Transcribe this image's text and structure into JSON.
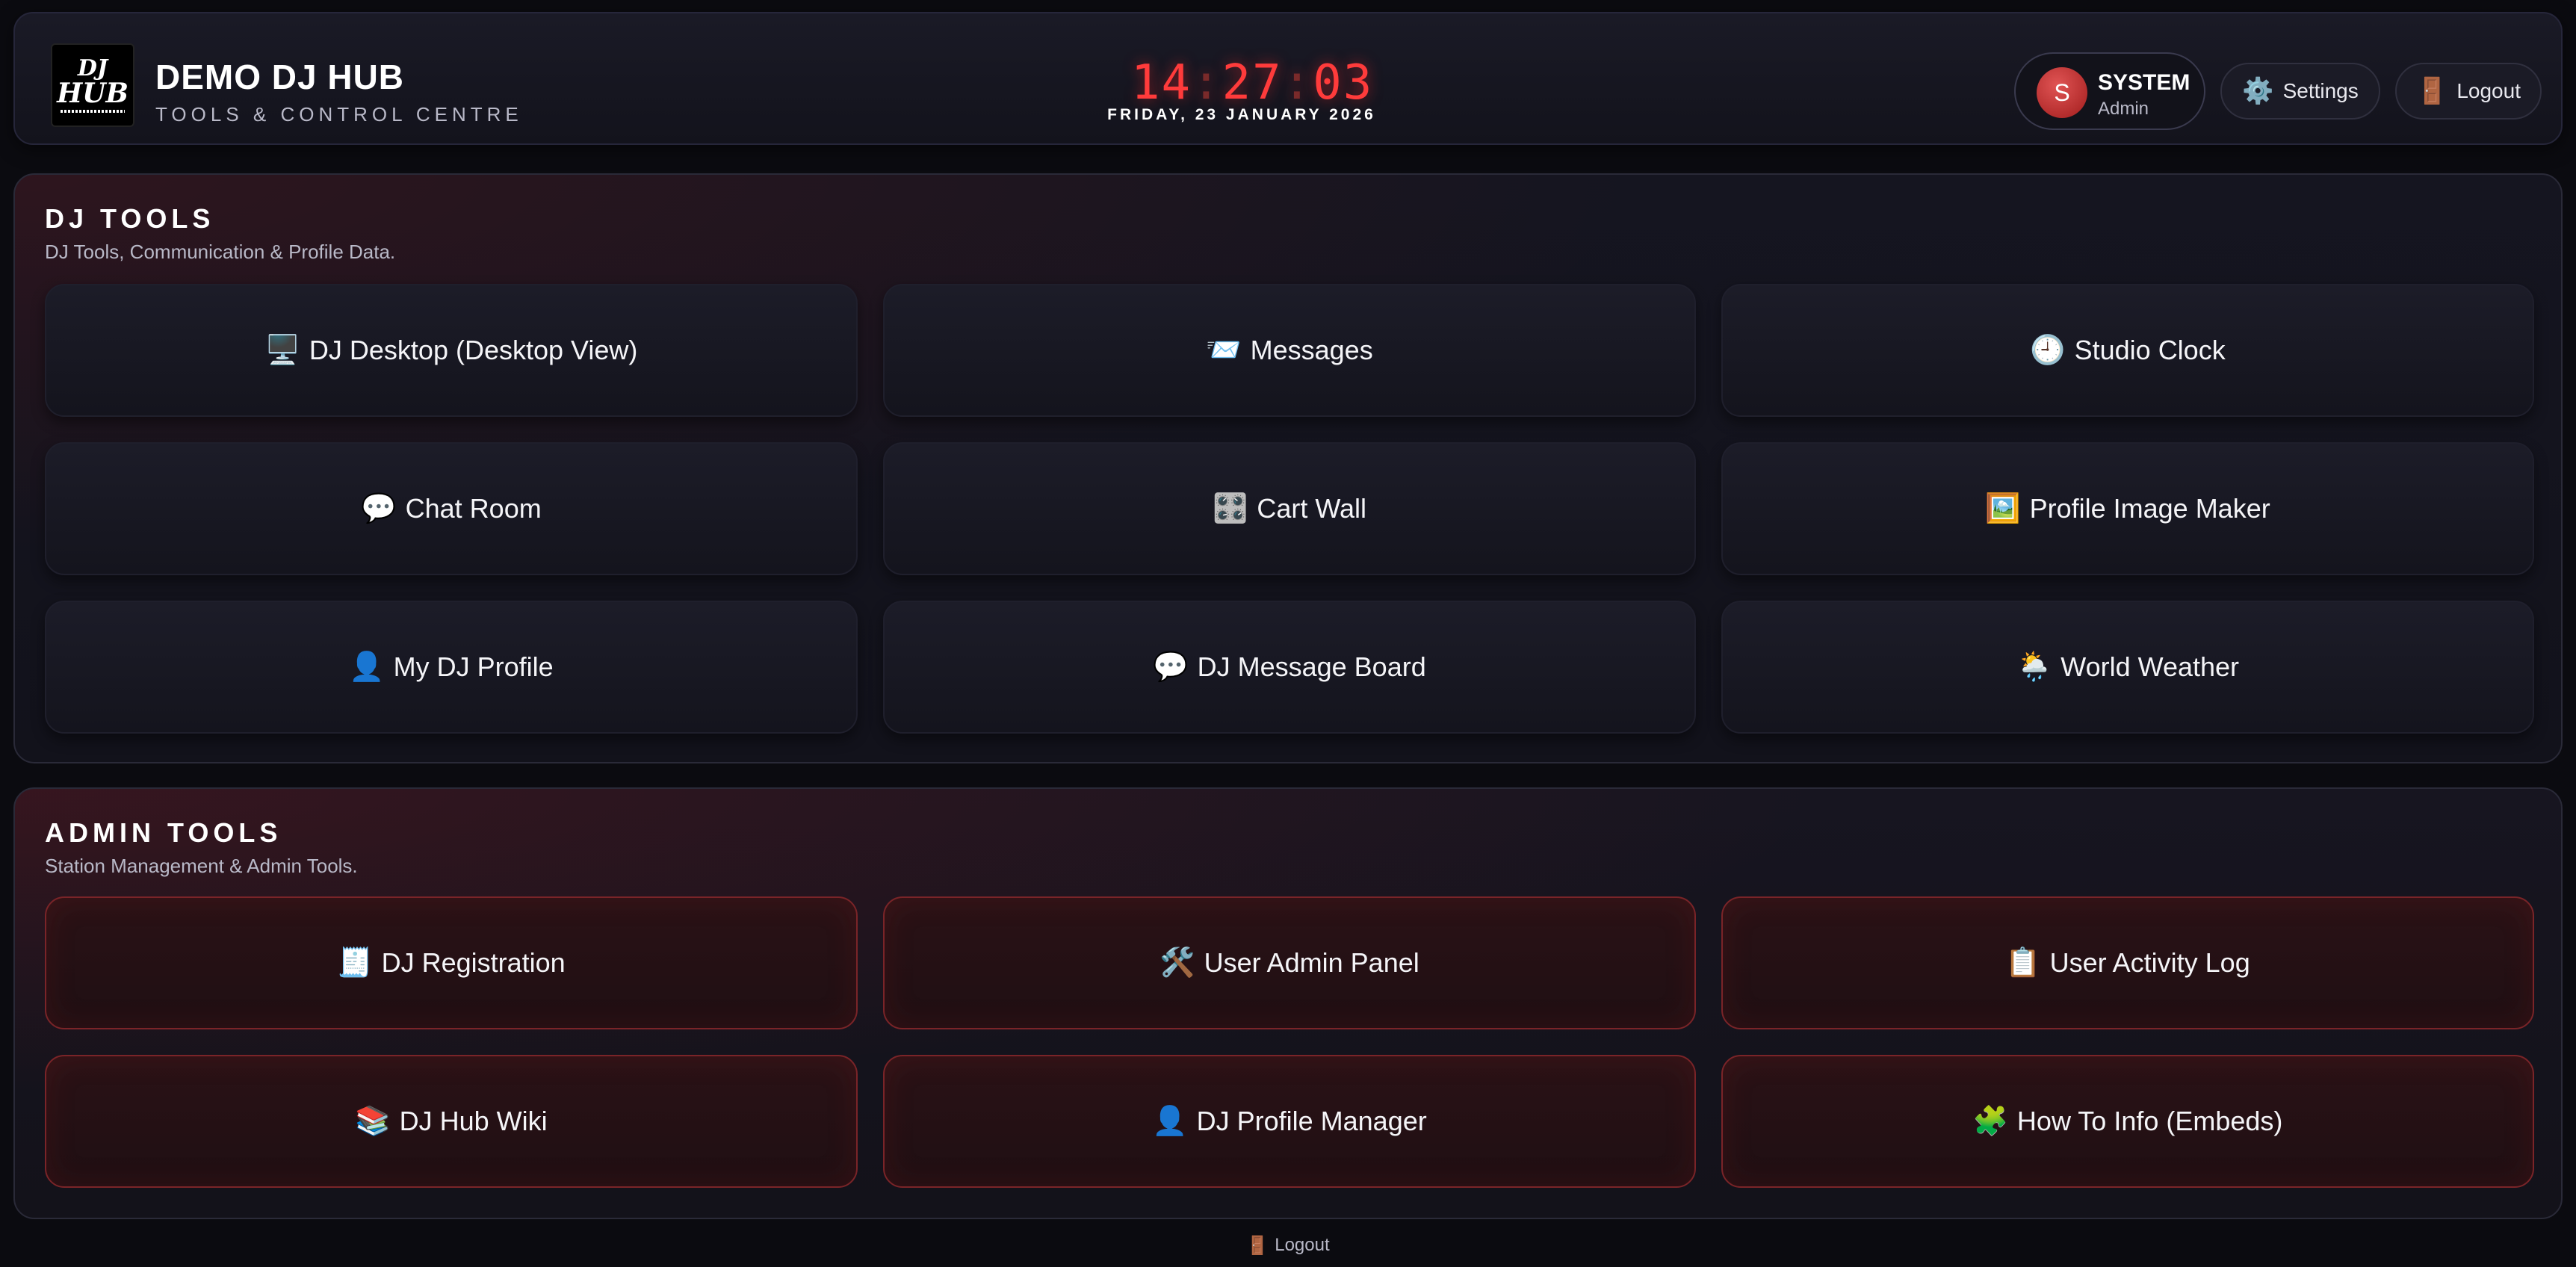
{
  "header": {
    "logo_top": "DJ",
    "logo_bottom": "HUB",
    "title": "DEMO DJ HUB",
    "subtitle": "TOOLS & CONTROL CENTRE",
    "clock": {
      "hh": "14",
      "mm": "27",
      "ss": "03",
      "sep": ":"
    },
    "date": "FRIDAY, 23 JANUARY 2026",
    "user": {
      "initial": "S",
      "name": "SYSTEM",
      "role": "Admin"
    },
    "settings_icon": "⚙️",
    "settings_label": "Settings",
    "logout_icon": "🚪",
    "logout_label": "Logout"
  },
  "dj_tools": {
    "title": "DJ TOOLS",
    "subtitle": "DJ Tools, Communication & Profile Data.",
    "tiles": [
      {
        "icon": "🖥️",
        "label": "DJ Desktop (Desktop View)"
      },
      {
        "icon": "📨",
        "label": "Messages"
      },
      {
        "icon": "🕘",
        "label": "Studio Clock"
      },
      {
        "icon": "💬",
        "label": "Chat Room"
      },
      {
        "icon": "🎛️",
        "label": "Cart Wall"
      },
      {
        "icon": "🖼️",
        "label": "Profile Image Maker"
      },
      {
        "icon": "👤",
        "label": "My DJ Profile"
      },
      {
        "icon": "💬",
        "label": "DJ Message Board"
      },
      {
        "icon": "🌦️",
        "label": "World Weather"
      }
    ]
  },
  "admin_tools": {
    "title": "ADMIN TOOLS",
    "subtitle": "Station Management & Admin Tools.",
    "tiles": [
      {
        "icon": "🧾",
        "label": "DJ Registration"
      },
      {
        "icon": "🛠️",
        "label": "User Admin Panel"
      },
      {
        "icon": "📋",
        "label": "User Activity Log"
      },
      {
        "icon": "📚",
        "label": "DJ Hub Wiki"
      },
      {
        "icon": "👤",
        "label": "DJ Profile Manager"
      },
      {
        "icon": "🧩",
        "label": "How To Info (Embeds)"
      }
    ]
  },
  "footer": {
    "logout_icon": "🚪",
    "logout_label": "Logout"
  },
  "colors": {
    "accent_red": "#ff3b3b",
    "admin_border": "#7a2428",
    "background": "#0b0b10"
  }
}
